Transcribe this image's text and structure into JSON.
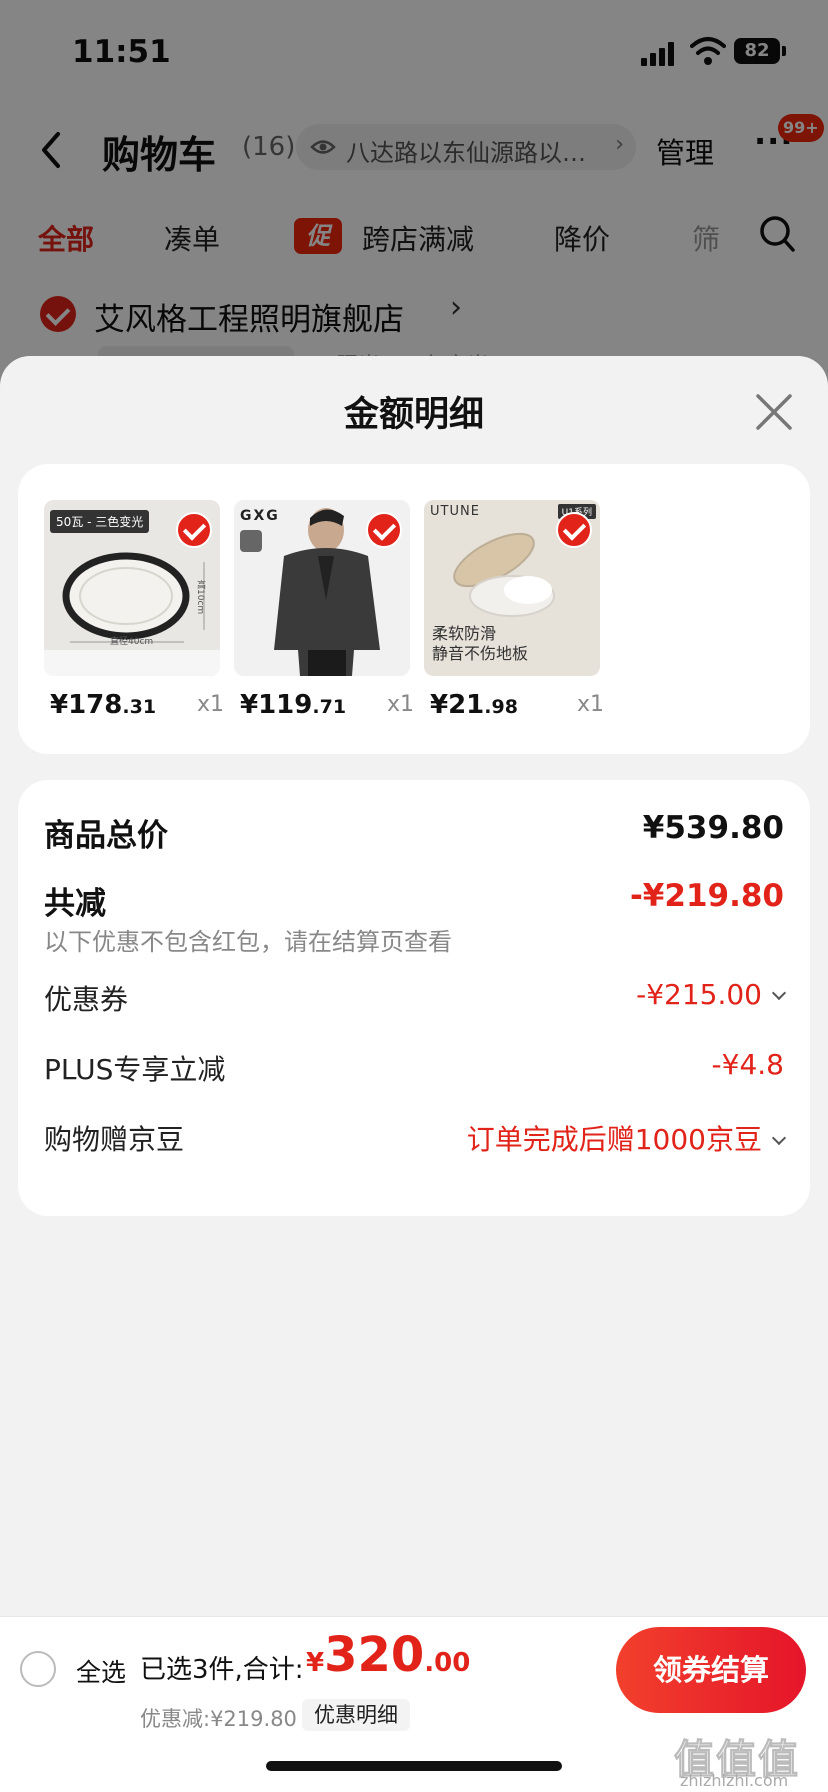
{
  "status_bar": {
    "time": "11:51",
    "battery": "82"
  },
  "nav": {
    "title": "购物车",
    "count": "(16)",
    "address": "八达路以东仙源路以…",
    "address_arrow": "›",
    "manage": "管理",
    "more": "···",
    "badge": "99+"
  },
  "tabs": {
    "all": "全部",
    "combine": "凑单",
    "promo_tag": "促",
    "cross_store": "跨店满减",
    "price_drop": "降价",
    "filter": "筛"
  },
  "store": {
    "name": "艾风格工程照明旗舰店",
    "arrow": "›",
    "peek_text": "照光 · 三色变光"
  },
  "sheet": {
    "title": "金额明细",
    "items": [
      {
        "price_int": "¥178",
        "price_dec": ".31",
        "qty": "x1",
        "img_tag": "50瓦 - 三色变光",
        "img_caption": "直径40cm",
        "img_side": "高10cm"
      },
      {
        "price_int": "¥119",
        "price_dec": ".71",
        "qty": "x1",
        "img_brand": "GXG"
      },
      {
        "price_int": "¥21",
        "price_dec": ".98",
        "qty": "x1",
        "img_brand": "UTUNE",
        "img_series": "U1系列",
        "img_text1": "柔软防滑",
        "img_text2": "静音不伤地板"
      }
    ],
    "summary": {
      "total_label": "商品总价",
      "total_value": "¥539.80",
      "reduce_label": "共减",
      "reduce_value": "-¥219.80",
      "reduce_note": "以下优惠不包含红包，请在结算页查看",
      "coupon_label": "优惠券",
      "coupon_value": "-¥215.00",
      "plus_label": "PLUS专享立减",
      "plus_value": "-¥4.8",
      "beans_label": "购物赠京豆",
      "beans_value": "订单完成后赠1000京豆"
    }
  },
  "bottom_bar": {
    "select_all": "全选",
    "selected_text": "已选3件,合计:",
    "total_currency": "¥",
    "total_int": "320",
    "total_dec": ".00",
    "discount": "优惠减:¥219.80",
    "discount_detail": "优惠明细",
    "checkout": "领券结算"
  },
  "watermark": {
    "title": "值值值",
    "site": "zhizhizhi.com"
  },
  "colors": {
    "accent": "#e2231a",
    "sheet_bg": "#f2f2f2",
    "card_bg": "#ffffff"
  }
}
